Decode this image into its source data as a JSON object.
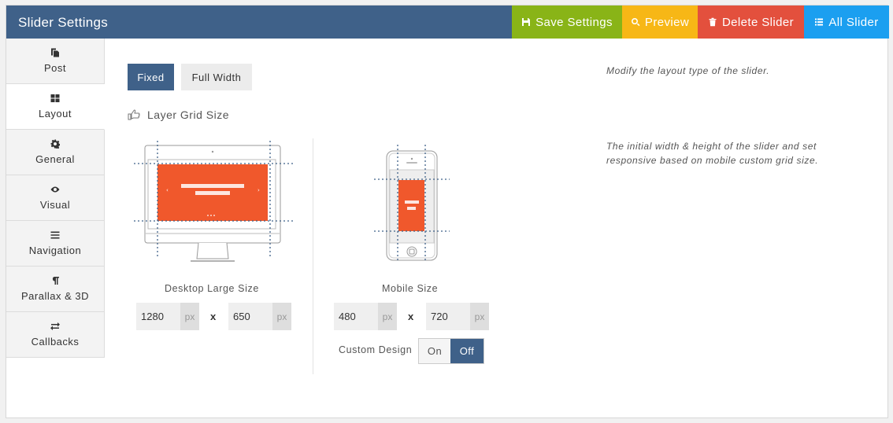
{
  "header": {
    "title": "Slider Settings",
    "buttons": {
      "save": "Save Settings",
      "preview": "Preview",
      "delete": "Delete Slider",
      "all": "All Slider"
    }
  },
  "sidebar": {
    "items": [
      {
        "label": "Post",
        "icon": "copy-icon"
      },
      {
        "label": "Layout",
        "icon": "grid-icon",
        "active": true
      },
      {
        "label": "General",
        "icon": "gear-icon"
      },
      {
        "label": "Visual",
        "icon": "eye-icon"
      },
      {
        "label": "Navigation",
        "icon": "list-icon"
      },
      {
        "label": "Parallax & 3D",
        "icon": "paragraph-icon"
      },
      {
        "label": "Callbacks",
        "icon": "exchange-icon"
      }
    ]
  },
  "layout_type": {
    "options": [
      "Fixed",
      "Full Width"
    ],
    "selected": "Fixed",
    "description": "Modify the layout type of the slider."
  },
  "grid": {
    "title": "Layer Grid Size",
    "description_line1": "The initial width & height of the slider and set",
    "description_line2": "responsive based on mobile custom grid size.",
    "desktop": {
      "caption": "Desktop Large Size",
      "width": "1280",
      "height": "650",
      "unit": "px"
    },
    "mobile": {
      "caption": "Mobile Size",
      "width": "480",
      "height": "720",
      "unit": "px"
    },
    "separator": "x",
    "custom_design": {
      "label": "Custom Design",
      "on": "On",
      "off": "Off",
      "selected": "Off"
    }
  },
  "colors": {
    "header_bg": "#3f6189",
    "save": "#89b417",
    "preview": "#f7b716",
    "delete": "#e3503d",
    "all": "#1b9ff0",
    "slide": "#f0582c"
  }
}
